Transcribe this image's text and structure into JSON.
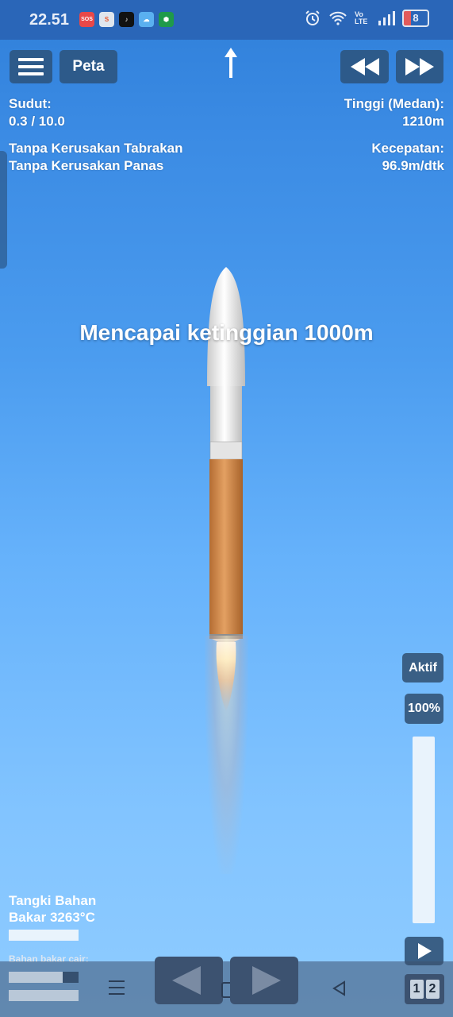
{
  "status_bar": {
    "time": "22.51",
    "app_icons": [
      {
        "name": "sos-icon",
        "text": "SOS",
        "bg": "#e94848"
      },
      {
        "name": "shopee-icon",
        "text": "S",
        "bg": "#dfe6ee"
      },
      {
        "name": "tiktok-icon",
        "text": "♪",
        "bg": "#111111"
      },
      {
        "name": "weather-icon",
        "text": "☁",
        "bg": "#5ab0f0"
      },
      {
        "name": "shield-app-icon",
        "text": "⬢",
        "bg": "#1f9a4a"
      }
    ],
    "signal_label": "Vo LTE",
    "battery": "8"
  },
  "toolbar": {
    "map_label": "Peta"
  },
  "left_panel": {
    "angle_label": "Sudut:",
    "angle_value": "0.3 / 10.0",
    "no_crash_damage": "Tanpa Kerusakan Tabrakan",
    "no_heat_damage": "Tanpa Kerusakan Panas"
  },
  "right_panel": {
    "altitude_label": "Tinggi (Medan):",
    "altitude_value": "1210m",
    "speed_label": "Kecepatan:",
    "speed_value": "96.9m/dtk"
  },
  "notice": "Mencapai ketinggian 1000m",
  "controls": {
    "active_label": "Aktif",
    "throttle_label": "100%",
    "throttle_level": 1.0
  },
  "fuel": {
    "label_line1": "Tangki Bahan",
    "label_line2": "Bakar 3263°C",
    "sub_label": "Bahan bakar cair:"
  },
  "stage": {
    "digit1": "1",
    "digit2": "2"
  },
  "colors": {
    "button": "#2d5a8a",
    "sky_top": "#2f7fd9",
    "sky_bottom": "#8fccff"
  }
}
